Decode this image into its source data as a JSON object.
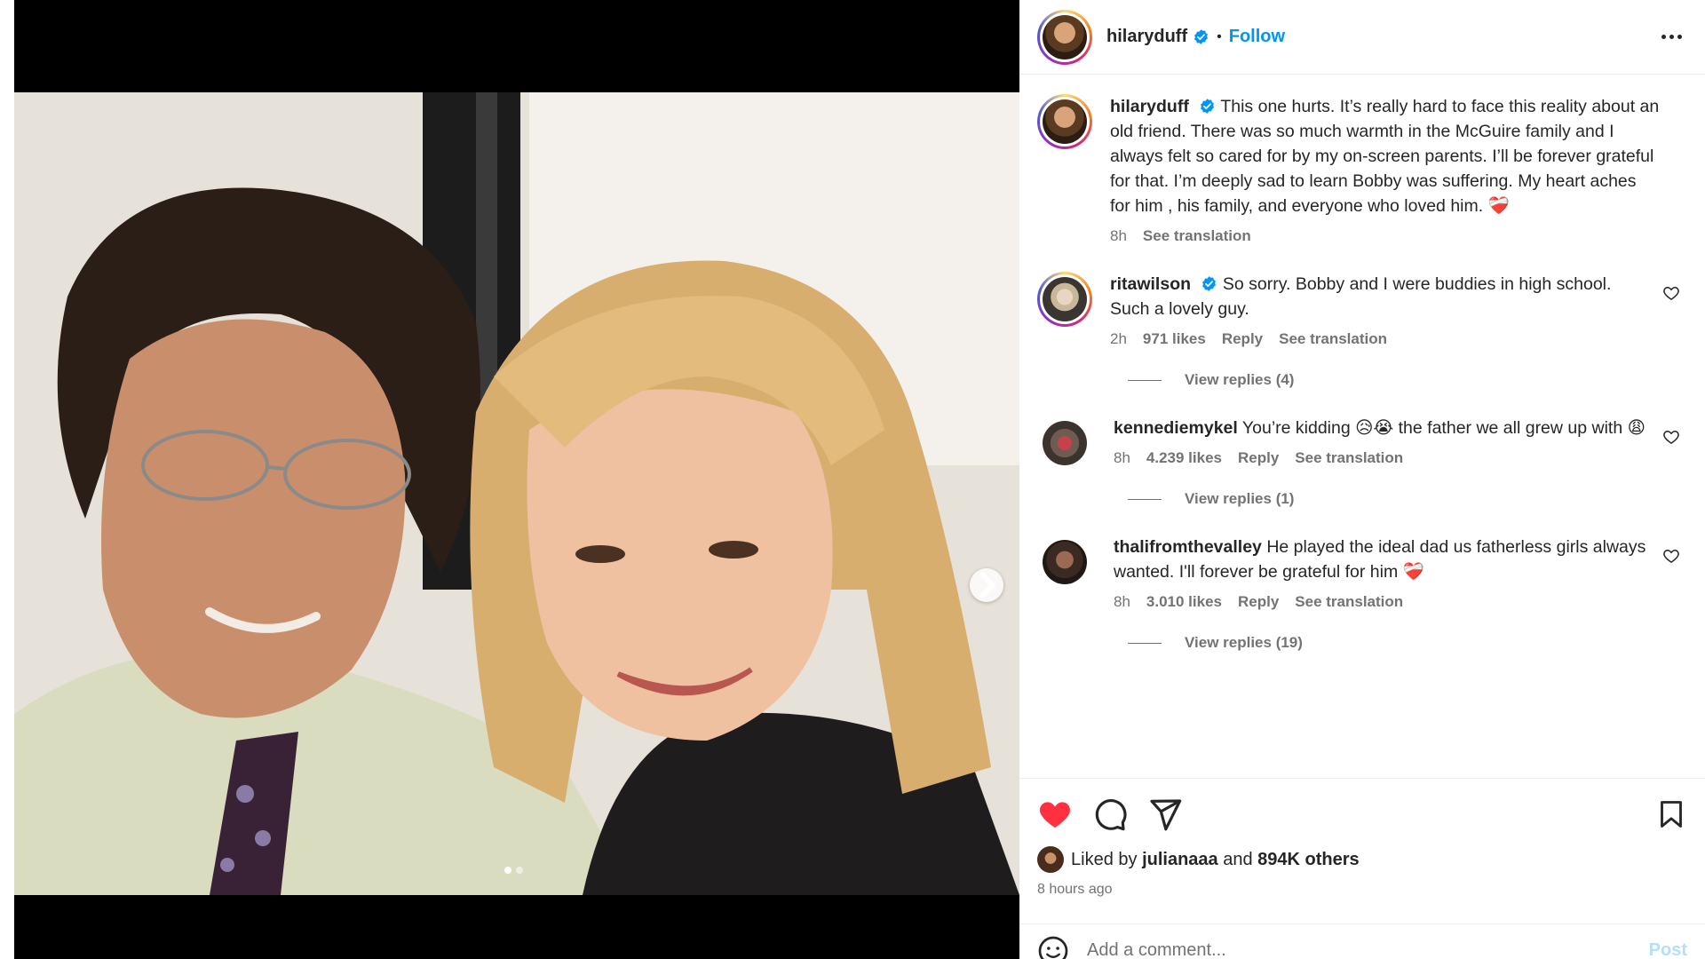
{
  "post": {
    "author": "hilaryduff",
    "follow_label": "Follow",
    "separator": "•",
    "carousel": {
      "current": 1,
      "total": 2
    }
  },
  "caption": {
    "author": "hilaryduff",
    "text": "This one hurts. It’s really hard to face this reality about an old friend. There was so much warmth in the McGuire family and I always felt so cared for by my on-screen parents. I’ll be forever grateful for that. I’m deeply sad to learn Bobby was suffering. My heart aches for him , his family, and everyone who loved him. ❤️‍🩹",
    "time": "8h",
    "see_translation": "See translation"
  },
  "comments": [
    {
      "username": "ritawilson",
      "verified": true,
      "text": "So sorry. Bobby and I were buddies in high school. Such a lovely guy.",
      "time": "2h",
      "likes": "971 likes",
      "reply": "Reply",
      "see_translation": "See translation",
      "view_replies": "View replies (4)"
    },
    {
      "username": "kennediemykel",
      "verified": false,
      "text": "You’re kidding 😥😭 the father we all grew up with 😩",
      "time": "8h",
      "likes": "4.239 likes",
      "reply": "Reply",
      "see_translation": "See translation",
      "view_replies": "View replies (1)"
    },
    {
      "username": "thalifromthevalley",
      "verified": false,
      "text": "He played the ideal dad us fatherless girls always wanted. I'll forever be grateful for him ❤️‍🩹",
      "time": "8h",
      "likes": "3.010 likes",
      "reply": "Reply",
      "see_translation": "See translation",
      "view_replies": "View replies (19)"
    }
  ],
  "likes": {
    "prefix": "Liked by",
    "user": "julianaaa",
    "and": "and",
    "others": "894K others",
    "time_ago": "8 hours ago"
  },
  "add_comment": {
    "placeholder": "Add a comment...",
    "post_label": "Post"
  },
  "colors": {
    "accent": "#0095f6",
    "like": "#ff3040",
    "muted": "#737373"
  }
}
